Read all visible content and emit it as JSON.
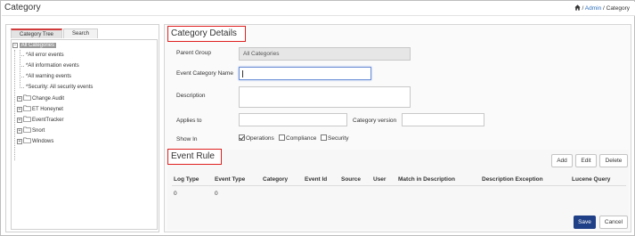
{
  "header": {
    "title": "Category",
    "breadcrumb": {
      "sep1": " / ",
      "admin": "Admin",
      "sep2": " / ",
      "current": "Category"
    }
  },
  "left_panel": {
    "tabs": [
      {
        "label": "Category Tree",
        "active": true
      },
      {
        "label": "Search",
        "active": false
      }
    ],
    "tree": {
      "root": "All Categories",
      "children_plain": [
        "*All error events",
        "*All information events",
        "*All warning events",
        "*Security: All security events"
      ],
      "folders": [
        "Change Audit",
        "ET Honeynet",
        "EventTracker",
        "Snort",
        "Windows"
      ]
    }
  },
  "details": {
    "heading": "Category Details",
    "parent_group_label": "Parent Group",
    "parent_group_value": "All Categories",
    "event_category_name_label": "Event Category Name",
    "event_category_name_value": "",
    "description_label": "Description",
    "applies_to_label": "Applies to",
    "applies_to_value": "",
    "category_version_label": "Category version",
    "category_version_value": "",
    "show_in_label": "Show In",
    "show_in_options": [
      {
        "label": "Operations",
        "checked": true
      },
      {
        "label": "Compliance",
        "checked": false
      },
      {
        "label": "Security",
        "checked": false
      }
    ]
  },
  "event_rule": {
    "heading": "Event Rule",
    "buttons": {
      "add": "Add",
      "edit": "Edit",
      "delete": "Delete"
    },
    "columns": [
      "Log Type",
      "Event Type",
      "Category",
      "Event Id",
      "Source",
      "User",
      "Match in Description",
      "Description Exception",
      "Lucene Query"
    ],
    "rows": [
      {
        "log_type": "0",
        "event_type": "0"
      }
    ]
  },
  "footer": {
    "save": "Save",
    "cancel": "Cancel"
  },
  "colors": {
    "accent": "#1f3f86",
    "highlight_border": "#e02020",
    "link": "#2a6ebb"
  }
}
